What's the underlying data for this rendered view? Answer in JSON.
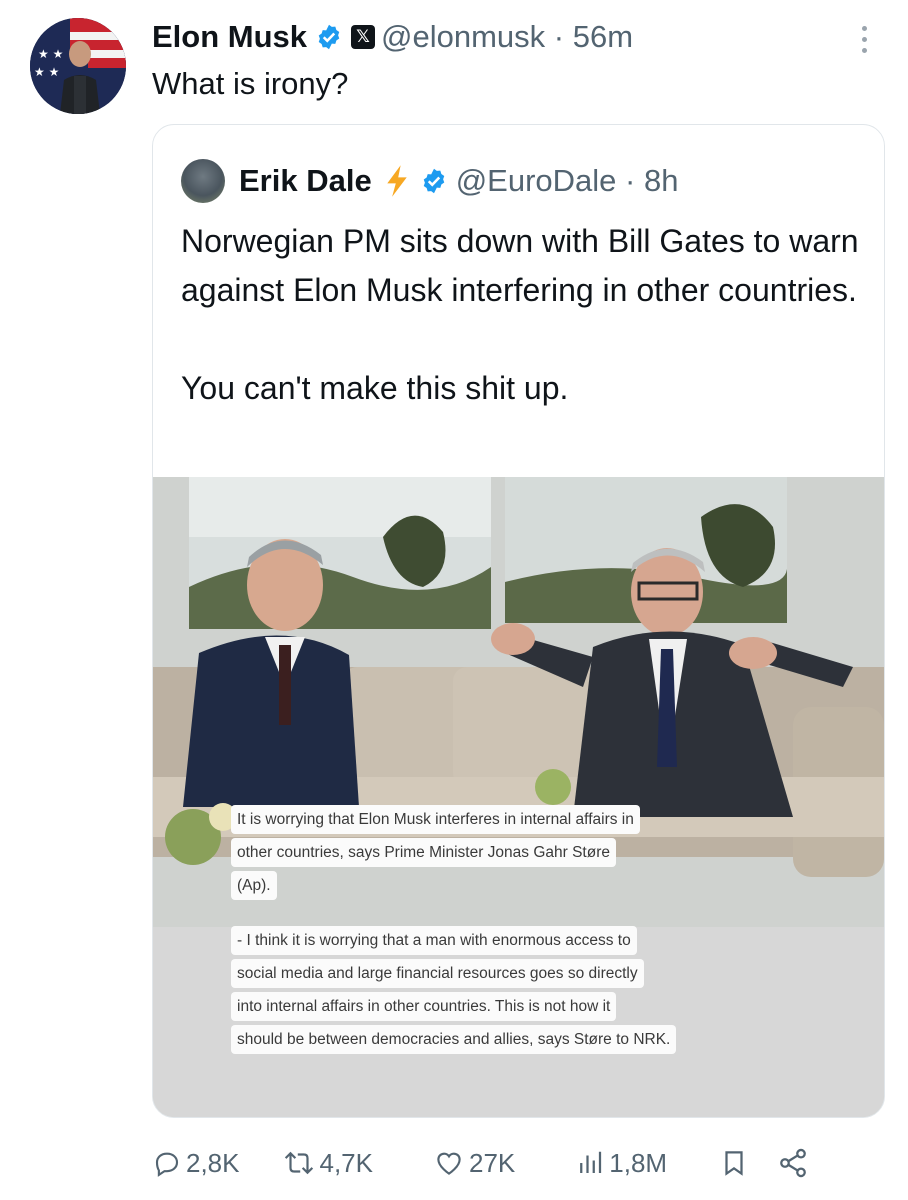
{
  "tweet": {
    "author_name": "Elon Musk",
    "handle_time": "@elonmusk · 56m",
    "text": "What is irony?",
    "avatar_icon": "user-avatar",
    "verified_color": "#1d9bf0"
  },
  "quoted": {
    "author_name": "Erik Dale",
    "handle_time": "@EuroDale · 8h",
    "text_line1": "Norwegian PM sits down with Bill Gates to warn against Elon Musk interfering in other countries.",
    "text_line2": "You can't make this shit up.",
    "image": {
      "caption_1": [
        "It is worrying that Elon Musk interferes in internal affairs in",
        "other countries, says Prime Minister Jonas Gahr Støre",
        "(Ap)."
      ],
      "caption_2": [
        "- I think it is worrying that a man with enormous access to",
        "social media and large financial resources goes so directly",
        "into internal affairs in other countries. This is not how it",
        "should be between democracies and allies, says Støre to NRK."
      ]
    }
  },
  "actions": {
    "replies": "2,8K",
    "reposts": "4,7K",
    "likes": "27K",
    "views": "1,8M"
  }
}
